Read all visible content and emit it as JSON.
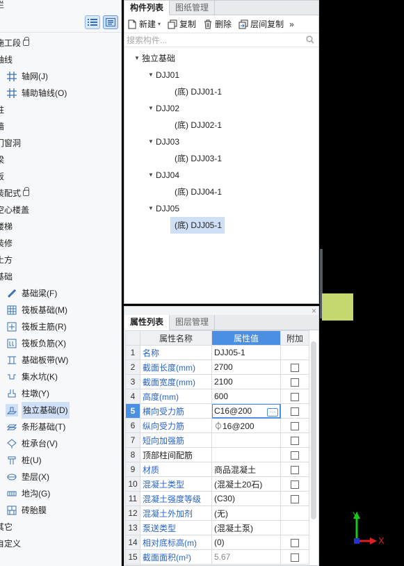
{
  "left_panel": {
    "top_partial": "栏",
    "tree": [
      {
        "label": "施工段",
        "level": 0,
        "lock": true
      },
      {
        "label": "轴线",
        "level": 0
      },
      {
        "label": "轴网(J)",
        "level": 1,
        "icon": "grid-icon"
      },
      {
        "label": "辅助轴线(O)",
        "level": 1,
        "icon": "grid-icon"
      },
      {
        "label": "柱",
        "level": 0
      },
      {
        "label": "墙",
        "level": 0
      },
      {
        "label": "门窗洞",
        "level": 0
      },
      {
        "label": "梁",
        "level": 0
      },
      {
        "label": "板",
        "level": 0
      },
      {
        "label": "装配式",
        "level": 0,
        "lock": true
      },
      {
        "label": "空心楼盖",
        "level": 0
      },
      {
        "label": "楼梯",
        "level": 0
      },
      {
        "label": "装修",
        "level": 0
      },
      {
        "label": "土方",
        "level": 0
      },
      {
        "label": "基础",
        "level": 0
      },
      {
        "label": "基础梁(F)",
        "level": 1,
        "icon": "beam-icon"
      },
      {
        "label": "筏板基础(M)",
        "level": 1,
        "icon": "raft-icon"
      },
      {
        "label": "筏板主筋(R)",
        "level": 1,
        "icon": "rebar-icon"
      },
      {
        "label": "筏板负筋(X)",
        "level": 1,
        "icon": "neg-rebar-icon"
      },
      {
        "label": "基础板带(W)",
        "level": 1,
        "icon": "strip-icon"
      },
      {
        "label": "集水坑(K)",
        "level": 1,
        "icon": "sump-icon"
      },
      {
        "label": "柱墩(Y)",
        "level": 1,
        "icon": "pier-icon"
      },
      {
        "label": "独立基础(D)",
        "level": 1,
        "icon": "footing-icon",
        "selected": true
      },
      {
        "label": "条形基础(T)",
        "level": 1,
        "icon": "strip-footing-icon"
      },
      {
        "label": "桩承台(V)",
        "level": 1,
        "icon": "pile-cap-icon"
      },
      {
        "label": "桩(U)",
        "level": 1,
        "icon": "pile-icon"
      },
      {
        "label": "垫层(X)",
        "level": 1,
        "icon": "cushion-icon"
      },
      {
        "label": "地沟(G)",
        "level": 1,
        "icon": "trench-icon"
      },
      {
        "label": "砖胎膜",
        "level": 1,
        "icon": "brick-icon"
      },
      {
        "label": "其它",
        "level": 0
      },
      {
        "label": "自定义",
        "level": 0
      }
    ]
  },
  "component_panel": {
    "tabs": [
      {
        "label": "构件列表",
        "active": true
      },
      {
        "label": "图纸管理",
        "active": false
      }
    ],
    "toolbar": {
      "new": "新建",
      "copy": "复制",
      "delete": "删除",
      "floor_copy": "层间复制",
      "more": "»"
    },
    "search_placeholder": "搜索构件...",
    "tree": [
      {
        "label": "独立基础",
        "level": 0,
        "expanded": true
      },
      {
        "label": "DJJ01",
        "level": 1,
        "expanded": true
      },
      {
        "label": "(底)  DJJ01-1",
        "level": 2
      },
      {
        "label": "DJJ02",
        "level": 1,
        "expanded": true
      },
      {
        "label": "(底)  DJJ02-1",
        "level": 2
      },
      {
        "label": "DJJ03",
        "level": 1,
        "expanded": true
      },
      {
        "label": "(底)  DJJ03-1",
        "level": 2
      },
      {
        "label": "DJJ04",
        "level": 1,
        "expanded": true
      },
      {
        "label": "(底)  DJJ04-1",
        "level": 2
      },
      {
        "label": "DJJ05",
        "level": 1,
        "expanded": true
      },
      {
        "label": "(底)  DJJ05-1",
        "level": 2,
        "selected": true
      }
    ]
  },
  "property_panel": {
    "close": "×",
    "tabs": [
      {
        "label": "属性列表",
        "active": true
      },
      {
        "label": "图层管理",
        "active": false
      }
    ],
    "headers": {
      "name": "属性名称",
      "value": "属性值",
      "extra": "附加"
    },
    "rows": [
      {
        "no": "1",
        "name": "名称",
        "value": "DJJ05-1",
        "blue": true,
        "check": false
      },
      {
        "no": "2",
        "name": "截面长度(mm)",
        "value": "2700",
        "blue": true,
        "check": true
      },
      {
        "no": "3",
        "name": "截面宽度(mm)",
        "value": "2100",
        "blue": true,
        "check": true
      },
      {
        "no": "4",
        "name": "高度(mm)",
        "value": "600",
        "blue": true,
        "check": true
      },
      {
        "no": "5",
        "name": "横向受力筋",
        "value": "C16@200",
        "blue": true,
        "check": true,
        "selected": true,
        "editing": true
      },
      {
        "no": "6",
        "name": "纵向受力筋",
        "value": "⏀16@200",
        "blue": true,
        "check": true
      },
      {
        "no": "7",
        "name": "短向加强筋",
        "value": "",
        "blue": true,
        "check": true
      },
      {
        "no": "8",
        "name": "顶部柱间配筋",
        "value": "",
        "blue": false,
        "check": true
      },
      {
        "no": "9",
        "name": "材质",
        "value": "商品混凝土",
        "blue": true,
        "check": true
      },
      {
        "no": "10",
        "name": "混凝土类型",
        "value": "(混凝土20石)",
        "blue": true,
        "check": true
      },
      {
        "no": "11",
        "name": "混凝土强度等级",
        "value": "(C30)",
        "blue": true,
        "check": true
      },
      {
        "no": "12",
        "name": "混凝土外加剂",
        "value": "(无)",
        "blue": true,
        "check": false
      },
      {
        "no": "13",
        "name": "泵送类型",
        "value": "(混凝土泵)",
        "blue": true,
        "check": false
      },
      {
        "no": "14",
        "name": "相对底标高(m)",
        "value": "(0)",
        "blue": true,
        "check": true
      },
      {
        "no": "15",
        "name": "截面面积(m²)",
        "value": "5.67",
        "blue": true,
        "check": true,
        "grey": true
      }
    ]
  },
  "canvas": {
    "axis_y": "Y",
    "axis_x": "X",
    "colors": {
      "block": "#c5d86d",
      "axis_y": "#19c919",
      "axis_x": "#e02020",
      "origin": "#2233cc"
    }
  }
}
